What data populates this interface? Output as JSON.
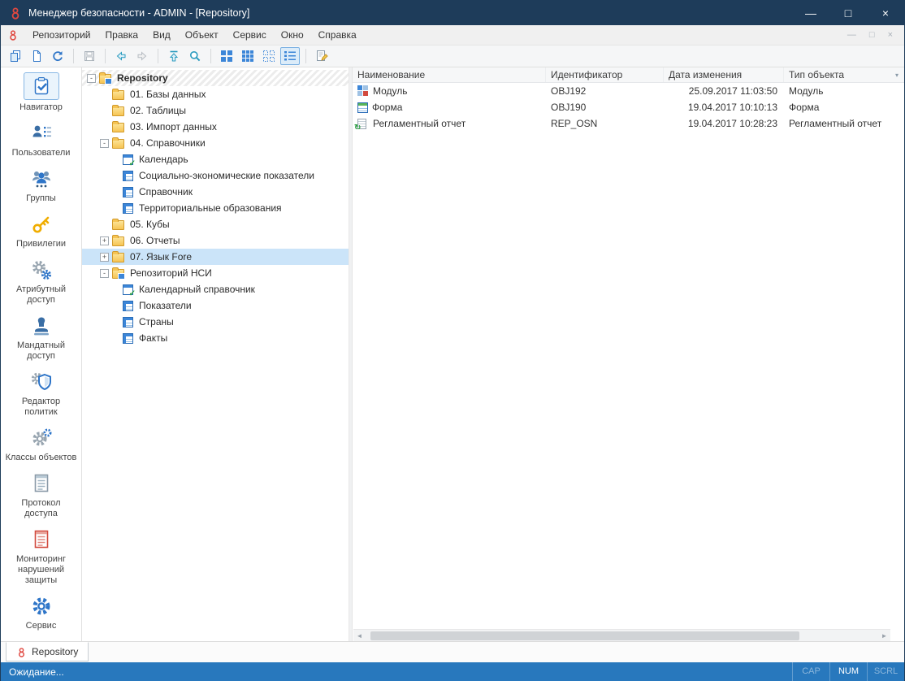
{
  "window": {
    "title": "Менеджер безопасности - ADMIN - [Repository]",
    "minimize": "—",
    "maximize": "□",
    "close": "×"
  },
  "menu": {
    "items": [
      "Репозиторий",
      "Правка",
      "Вид",
      "Объект",
      "Сервис",
      "Окно",
      "Справка"
    ],
    "mdi_minimize": "—",
    "mdi_restore": "□",
    "mdi_close": "×"
  },
  "toolbar": {
    "icons": [
      "new-object",
      "open-object",
      "refresh",
      "save",
      "back",
      "forward",
      "go-to-top",
      "search",
      "large-icons-view",
      "small-icons-view",
      "list-view",
      "details-view",
      "edit-note"
    ],
    "selected_view": "details-view"
  },
  "sidebar": {
    "items": [
      {
        "label": "Навигатор",
        "icon": "navigator",
        "selected": true
      },
      {
        "label": "Пользователи",
        "icon": "users",
        "selected": false
      },
      {
        "label": "Группы",
        "icon": "groups",
        "selected": false
      },
      {
        "label": "Привилегии",
        "icon": "privileges",
        "selected": false
      },
      {
        "label": "Атрибутный доступ",
        "icon": "attribute-access",
        "selected": false
      },
      {
        "label": "Мандатный доступ",
        "icon": "mandatory-access",
        "selected": false
      },
      {
        "label": "Редактор политик",
        "icon": "policy-editor",
        "selected": false
      },
      {
        "label": "Классы объектов",
        "icon": "object-classes",
        "selected": false
      },
      {
        "label": "Протокол доступа",
        "icon": "access-protocol",
        "selected": false
      },
      {
        "label": "Мониторинг нарушений защиты",
        "icon": "violation-monitoring",
        "selected": false
      },
      {
        "label": "Сервис",
        "icon": "service",
        "selected": false
      }
    ]
  },
  "tree": {
    "items": [
      {
        "label": "Repository",
        "level": 0,
        "expander": "-",
        "icon": "repository-folder",
        "bold": true,
        "hatch": true,
        "selected": false
      },
      {
        "label": "01. Базы данных",
        "level": 1,
        "expander": "",
        "icon": "folder",
        "selected": false
      },
      {
        "label": "02. Таблицы",
        "level": 1,
        "expander": "",
        "icon": "folder",
        "selected": false
      },
      {
        "label": "03. Импорт данных",
        "level": 1,
        "expander": "",
        "icon": "folder",
        "selected": false
      },
      {
        "label": "04. Справочники",
        "level": 1,
        "expander": "-",
        "icon": "folder",
        "selected": false
      },
      {
        "label": "Календарь",
        "level": 2,
        "expander": "",
        "icon": "calendar-dictionary",
        "selected": false
      },
      {
        "label": "Социально-экономические показатели",
        "level": 2,
        "expander": "",
        "icon": "dictionary",
        "selected": false
      },
      {
        "label": "Справочник",
        "level": 2,
        "expander": "",
        "icon": "dictionary",
        "selected": false
      },
      {
        "label": "Территориальные образования",
        "level": 2,
        "expander": "",
        "icon": "dictionary",
        "selected": false
      },
      {
        "label": "05. Кубы",
        "level": 1,
        "expander": "",
        "icon": "folder",
        "selected": false
      },
      {
        "label": "06. Отчеты",
        "level": 1,
        "expander": "+",
        "icon": "folder",
        "selected": false
      },
      {
        "label": "07. Язык Fore",
        "level": 1,
        "expander": "+",
        "icon": "folder",
        "selected": true
      },
      {
        "label": "Репозиторий НСИ",
        "level": 1,
        "expander": "-",
        "icon": "nsi-repository",
        "selected": false
      },
      {
        "label": "Календарный справочник",
        "level": 2,
        "expander": "",
        "icon": "calendar-dictionary",
        "selected": false
      },
      {
        "label": "Показатели",
        "level": 2,
        "expander": "",
        "icon": "dictionary",
        "selected": false
      },
      {
        "label": "Страны",
        "level": 2,
        "expander": "",
        "icon": "dictionary",
        "selected": false
      },
      {
        "label": "Факты",
        "level": 2,
        "expander": "",
        "icon": "dictionary",
        "selected": false
      }
    ]
  },
  "table": {
    "columns": [
      "Наименование",
      "Идентификатор",
      "Дата изменения",
      "Тип объекта"
    ],
    "rows": [
      {
        "name": "Модуль",
        "id": "OBJ192",
        "modified": "25.09.2017 11:03:50",
        "type": "Модуль",
        "icon": "module"
      },
      {
        "name": "Форма",
        "id": "OBJ190",
        "modified": "19.04.2017 10:10:13",
        "type": "Форма",
        "icon": "form"
      },
      {
        "name": "Регламентный отчет",
        "id": "REP_OSN",
        "modified": "19.04.2017 10:28:23",
        "type": "Регламентный отчет",
        "icon": "regular-report"
      }
    ]
  },
  "tabs": {
    "items": [
      {
        "label": "Repository"
      }
    ]
  },
  "statusbar": {
    "text": "Ожидание...",
    "indicators": [
      {
        "label": "CAP",
        "active": false
      },
      {
        "label": "NUM",
        "active": true
      },
      {
        "label": "SCRL",
        "active": false
      }
    ]
  }
}
